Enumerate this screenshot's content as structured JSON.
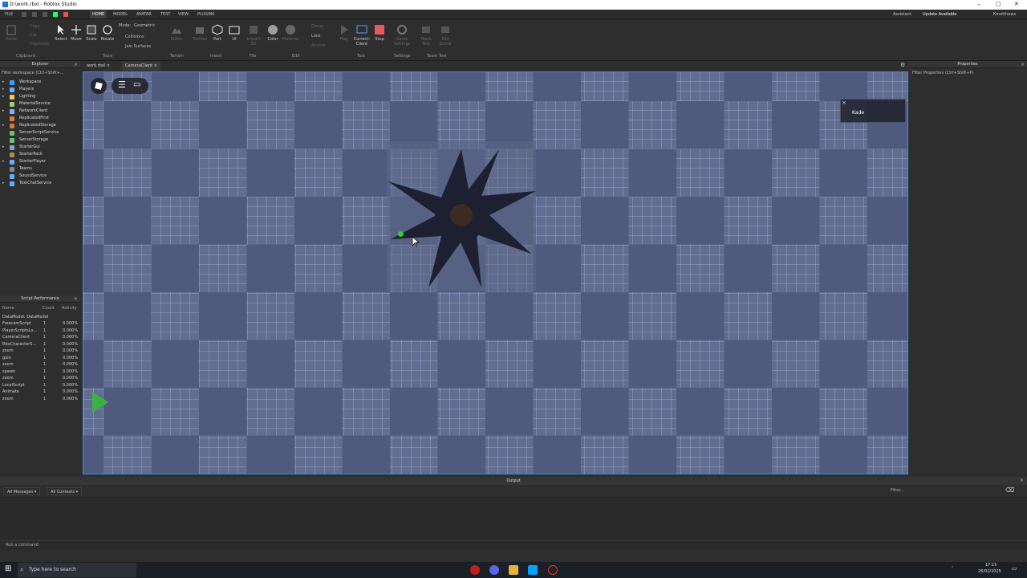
{
  "window": {
    "title": "D:\\work.rbxl - Roblox Studio"
  },
  "menu": {
    "file": "FILE",
    "tabs": [
      "HOME",
      "MODEL",
      "AVATAR",
      "TEST",
      "VIEW",
      "PLUGINS"
    ],
    "assistant": "Assistant",
    "update": "Update Available",
    "user": "Kmotthews"
  },
  "ribbon": {
    "clipboard": {
      "paste": "Paste",
      "copy": "Copy",
      "cut": "Cut",
      "duplicate": "Duplicate",
      "group": "Clipboard"
    },
    "tools": {
      "select": "Select",
      "move": "Move",
      "scale": "Scale",
      "rotate": "Rotate",
      "mode_label": "Mode:",
      "mode_value": "Geometric",
      "collisions": "Collisions",
      "join_surfaces": "Join Surfaces",
      "group": "Tools"
    },
    "terrain": {
      "editor": "Editor",
      "group": "Terrain"
    },
    "insert": {
      "toolbox": "Toolbox",
      "part": "Part",
      "ui": "UI",
      "group": "Insert"
    },
    "file": {
      "import3d": "Import 3D",
      "group": "File"
    },
    "edit": {
      "color": "Color",
      "material": "Material",
      "group_btn": "Group",
      "lock": "Lock",
      "anchor": "Anchor",
      "group": "Edit"
    },
    "test": {
      "play": "Play",
      "current": "Current:",
      "client": "Client",
      "stop": "Stop",
      "group": "Test"
    },
    "settings": {
      "game_settings": "Game Settings",
      "group": "Settings"
    },
    "team_test": {
      "team_test": "Team Test",
      "exit_game": "Exit Game",
      "group": "Team Test"
    }
  },
  "explorer": {
    "title": "Explorer",
    "filter": "Filter workspace (Ctrl+Shift+...",
    "items": [
      {
        "label": "Workspace",
        "color": "#3aa0ff",
        "expand": true
      },
      {
        "label": "Players",
        "color": "#5fb0ff",
        "expand": true
      },
      {
        "label": "Lighting",
        "color": "#f2c94c",
        "expand": true
      },
      {
        "label": "MaterialService",
        "color": "#9ad07a",
        "expand": false
      },
      {
        "label": "NetworkClient",
        "color": "#8ab4f8",
        "expand": true
      },
      {
        "label": "ReplicatedFirst",
        "color": "#d67b3a",
        "expand": false
      },
      {
        "label": "ReplicatedStorage",
        "color": "#d67b3a",
        "expand": true
      },
      {
        "label": "ServerScriptService",
        "color": "#6cc06c",
        "expand": false
      },
      {
        "label": "ServerStorage",
        "color": "#6cc06c",
        "expand": false
      },
      {
        "label": "StarterGui",
        "color": "#8aa0c8",
        "expand": true
      },
      {
        "label": "StarterPack",
        "color": "#b08850",
        "expand": false
      },
      {
        "label": "StarterPlayer",
        "color": "#5fb0ff",
        "expand": true
      },
      {
        "label": "Teams",
        "color": "#888888",
        "expand": false
      },
      {
        "label": "SoundService",
        "color": "#5fb0ff",
        "expand": false
      },
      {
        "label": "TextChatService",
        "color": "#5fb0ff",
        "expand": true
      }
    ]
  },
  "perf": {
    "title": "Script Performance",
    "headers": [
      "Name",
      "Count",
      "Activity"
    ],
    "datamodel": "DataModel: DataModel",
    "rows": [
      [
        "FreecamScript",
        "1",
        "0.000%"
      ],
      [
        "PlayerScriptsLo...",
        "1",
        "0.000%"
      ],
      [
        "CameraClient",
        "1",
        "0.000%"
      ],
      [
        "RbxCharacterS...",
        "1",
        "0.000%"
      ],
      [
        "zoom",
        "1",
        "0.000%"
      ],
      [
        "gain",
        "1",
        "0.000%"
      ],
      [
        "zoom",
        "1",
        "0.000%"
      ],
      [
        "spawn",
        "1",
        "0.000%"
      ],
      [
        "zoom",
        "1",
        "0.000%"
      ],
      [
        "LocalScript",
        "1",
        "0.000%"
      ],
      [
        "Animate",
        "1",
        "0.000%"
      ],
      [
        "zoom",
        "1",
        "0.000%"
      ]
    ]
  },
  "tabs": [
    "work.rbxl",
    "CameraClient"
  ],
  "viewport": {
    "player_name": "Kade"
  },
  "properties": {
    "title": "Properties",
    "filter": "Filter Properties (Ctrl+Shift+P)"
  },
  "output": {
    "title": "Output",
    "messages_dd": "All Messages",
    "contexts_dd": "All Contexts",
    "filter": "Filter...",
    "command": "Run a command"
  },
  "taskbar": {
    "search": "Type here to search",
    "time": "17:15",
    "date": "26/02/2025"
  }
}
